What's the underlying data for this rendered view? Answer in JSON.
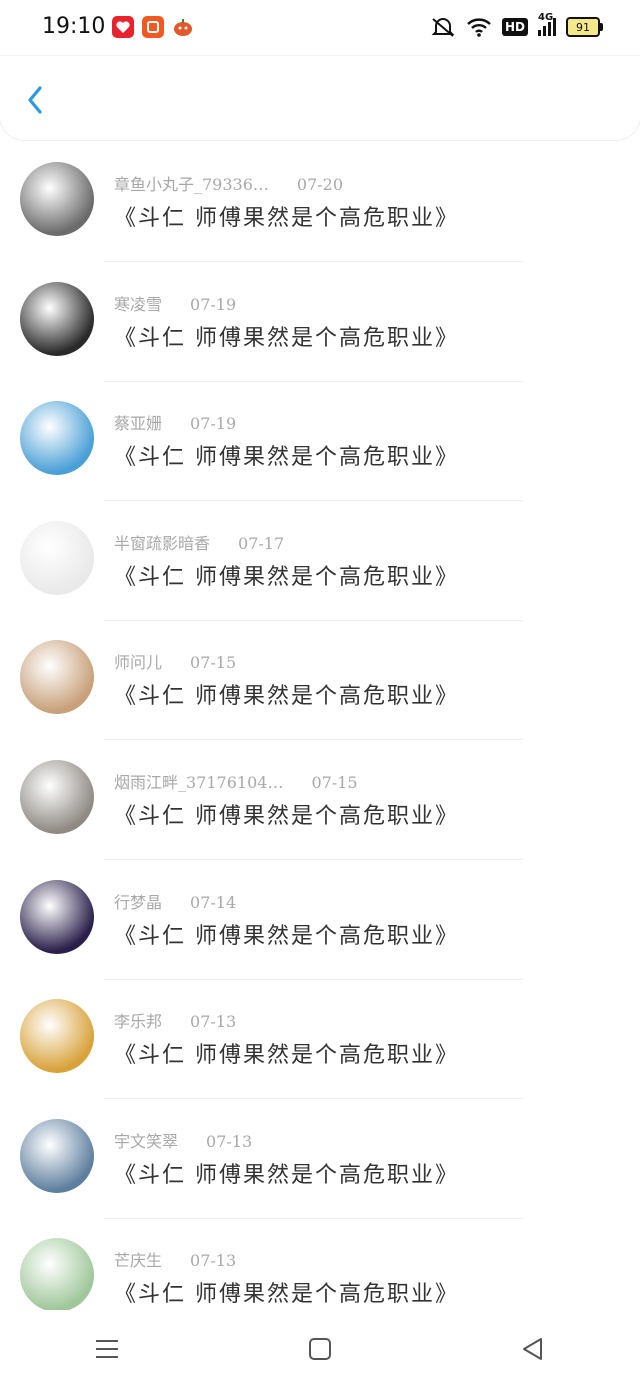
{
  "status_bar": {
    "time": "19:10",
    "app_icons": [
      "pinduoduo-icon",
      "taobao-icon",
      "game-icon"
    ],
    "system_icons": [
      "mute-icon",
      "wifi-icon",
      "hd-icon",
      "4g-signal-icon"
    ],
    "hd_label": "HD",
    "network_label": "4G",
    "battery_level": "91"
  },
  "header": {
    "back_icon": "chevron-left-icon",
    "accent_color": "#2d9ae0"
  },
  "comments": [
    {
      "user": "章鱼小丸子_79336…",
      "date": "07-20",
      "title": "《斗仁  师傅果然是个高危职业》",
      "avatar_color": "#6b6b6b"
    },
    {
      "user": "寒凌雪",
      "date": "07-19",
      "title": "《斗仁  师傅果然是个高危职业》",
      "avatar_color": "#2a2a2a"
    },
    {
      "user": "蔡亚姗",
      "date": "07-19",
      "title": "《斗仁  师傅果然是个高危职业》",
      "avatar_color": "#4a9fd6"
    },
    {
      "user": "半窗疏影暗香",
      "date": "07-17",
      "title": "《斗仁  师傅果然是个高危职业》",
      "avatar_color": "#e9e9e9"
    },
    {
      "user": "师问儿",
      "date": "07-15",
      "title": "《斗仁  师傅果然是个高危职业》",
      "avatar_color": "#c8a07a"
    },
    {
      "user": "烟雨江畔_37176104…",
      "date": "07-15",
      "title": "《斗仁  师傅果然是个高危职业》",
      "avatar_color": "#8f8a84"
    },
    {
      "user": "行梦晶",
      "date": "07-14",
      "title": "《斗仁  师傅果然是个高危职业》",
      "avatar_color": "#2a1f4a"
    },
    {
      "user": "李乐邦",
      "date": "07-13",
      "title": "《斗仁  师傅果然是个高危职业》",
      "avatar_color": "#d8a23a"
    },
    {
      "user": "宇文笑翠",
      "date": "07-13",
      "title": "《斗仁  师傅果然是个高危职业》",
      "avatar_color": "#5f7f9f"
    },
    {
      "user": "芒庆生",
      "date": "07-13",
      "title": "《斗仁  师傅果然是个高危职业》",
      "avatar_color": "#9fc79a"
    }
  ],
  "nav_bar": {
    "icons": [
      "menu-icon",
      "home-square-icon",
      "back-triangle-icon"
    ]
  }
}
